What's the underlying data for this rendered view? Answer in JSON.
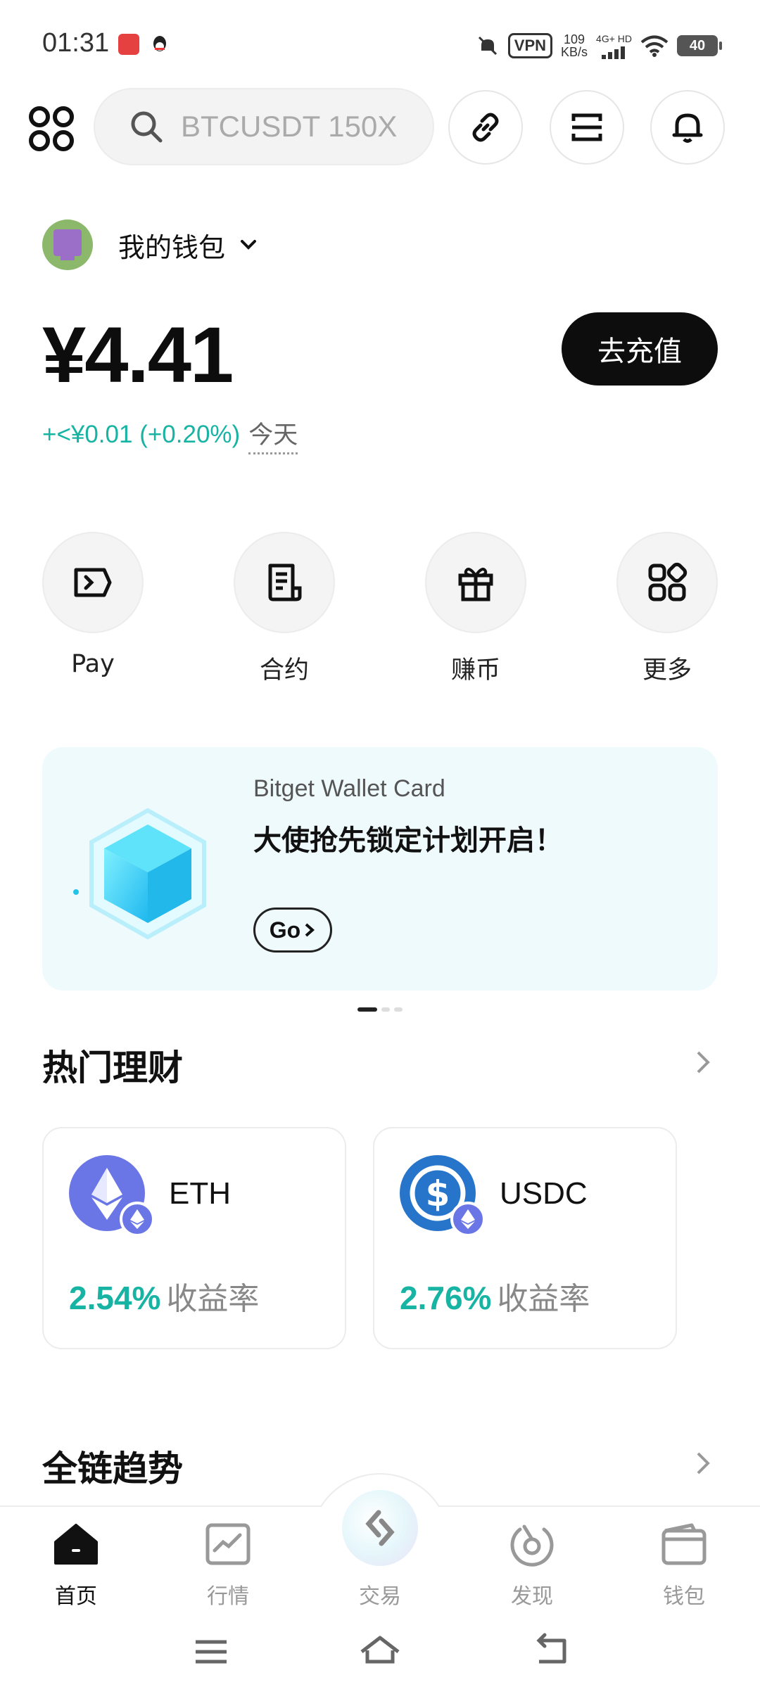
{
  "status_bar": {
    "time": "01:31",
    "speed_value": "109",
    "speed_unit": "KB/s",
    "network": "4G+ HD",
    "vpn": "VPN",
    "battery": "40"
  },
  "top_bar": {
    "search_placeholder": "BTCUSDT 150X",
    "icons": [
      "apps-grid-icon",
      "search-icon",
      "link-icon",
      "scan-icon",
      "bell-icon"
    ]
  },
  "wallet": {
    "name": "我的钱包",
    "balance": "¥4.41",
    "deposit_label": "去充值",
    "change": "+<¥0.01 (+0.20%)",
    "period": "今天"
  },
  "quick_actions": [
    {
      "label": "Pay",
      "icon": "pay-icon"
    },
    {
      "label": "合约",
      "icon": "contract-icon"
    },
    {
      "label": "赚币",
      "icon": "gift-icon"
    },
    {
      "label": "更多",
      "icon": "more-grid-icon"
    }
  ],
  "banner": {
    "subtitle": "Bitget Wallet Card",
    "title": "大使抢先锁定计划开启！",
    "cta": "Go"
  },
  "earn_section": {
    "title": "热门理财",
    "cards": [
      {
        "coin": "ETH",
        "apy": "2.54%",
        "apy_label": "收益率",
        "color": "#6a76e6"
      },
      {
        "coin": "USDC",
        "apy": "2.76%",
        "apy_label": "收益率",
        "color": "#2775ca"
      }
    ]
  },
  "trend_section": {
    "title": "全链趋势"
  },
  "bottom_nav": [
    {
      "label": "首页",
      "icon": "home-icon",
      "active": true
    },
    {
      "label": "行情",
      "icon": "chart-icon",
      "active": false
    },
    {
      "label": "交易",
      "icon": "trade-icon",
      "active": false
    },
    {
      "label": "发现",
      "icon": "discover-icon",
      "active": false
    },
    {
      "label": "钱包",
      "icon": "wallet-icon",
      "active": false
    }
  ],
  "colors": {
    "accent_green": "#17b3a3",
    "dark": "#0d0d0d",
    "banner_bg": "#effafd"
  }
}
